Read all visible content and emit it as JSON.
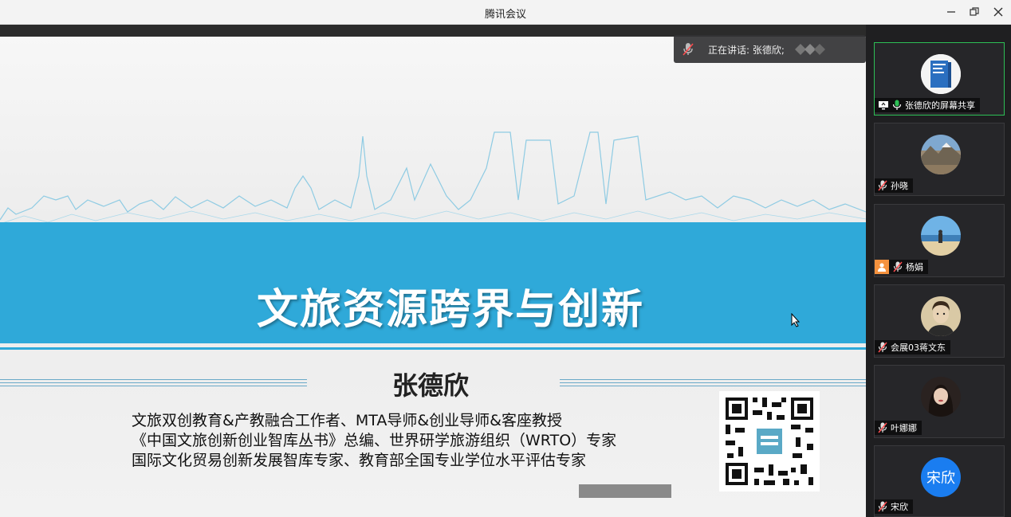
{
  "window": {
    "title": "腾讯会议",
    "controls": {
      "minimize": "—",
      "restore": "❐",
      "close": "✕"
    }
  },
  "speaking_banner": {
    "text": "正在讲话: 张德欣;"
  },
  "slide": {
    "title": "文旅资源跨界与创新",
    "presenter": "张德欣",
    "bio_lines": [
      "文旅双创教育&产教融合工作者、MTA导师&创业导师&客座教授",
      "《中国文旅创新创业智库丛书》总编、世界研学旅游组织（WRTO）专家",
      "国际文化贸易创新发展智库专家、教育部全国专业学位水平评估专家"
    ],
    "colors": {
      "band": "#2fa9d9",
      "title": "#ffffff"
    }
  },
  "participants": [
    {
      "name": "张德欣的屏幕共享",
      "avatar": "book-cover-avatar",
      "mic": "on",
      "screen_share": true,
      "active": true
    },
    {
      "name": "孙晓",
      "avatar": "mountain-avatar",
      "mic": "muted"
    },
    {
      "name": "杨娟",
      "avatar": "beach-avatar",
      "mic": "muted",
      "badge": "person-icon"
    },
    {
      "name": "会展03蒋文东",
      "avatar": "portrait-avatar",
      "mic": "muted"
    },
    {
      "name": "叶娜娜",
      "avatar": "woman-avatar",
      "mic": "muted"
    },
    {
      "name": "宋欣",
      "avatar_text": "宋欣",
      "mic": "muted"
    }
  ],
  "accent_colors": {
    "active_border": "#2dbf55",
    "letter_avatar": "#1a7df0",
    "muted_icon": "#ff4d4f"
  }
}
